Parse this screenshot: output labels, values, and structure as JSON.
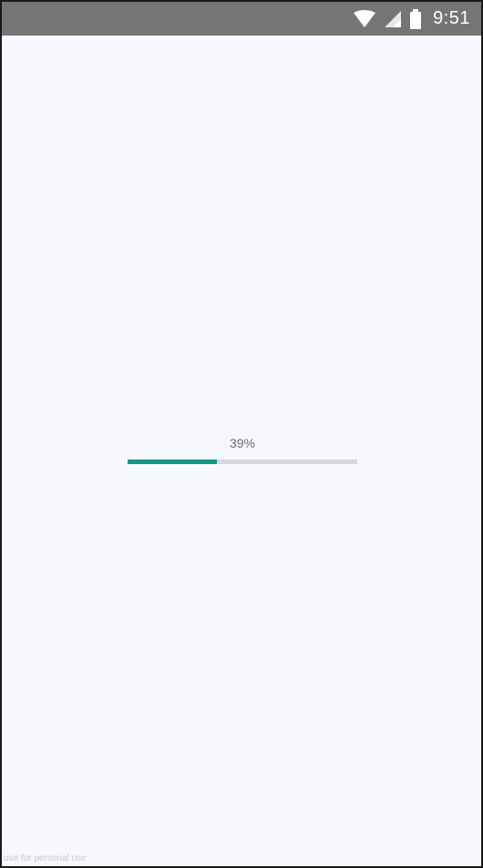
{
  "status_bar": {
    "time": "9:51",
    "icons": [
      "wifi-icon",
      "signal-icon",
      "battery-icon"
    ],
    "background": "#757575",
    "foreground": "#ffffff"
  },
  "progress": {
    "label": "39%",
    "value": 0.39,
    "fill_color": "#0f9a84",
    "track_color": "#d7d8de",
    "text_color": "#6d6d6d"
  },
  "screen": {
    "background": "#f7f8fd",
    "watermark": "use for personal use"
  }
}
